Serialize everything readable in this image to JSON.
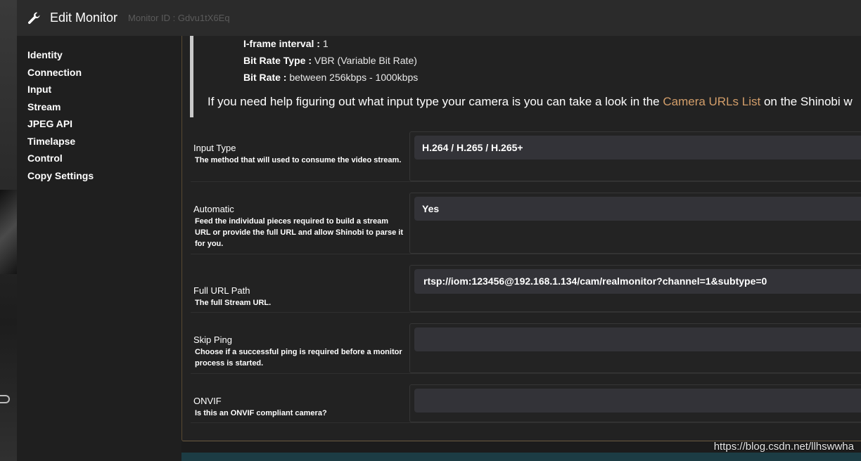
{
  "header": {
    "title": "Edit Monitor",
    "monitor_id": "Monitor ID : Gdvu1tX6Eq"
  },
  "sidebar": {
    "items": [
      {
        "label": "Identity"
      },
      {
        "label": "Connection"
      },
      {
        "label": "Input"
      },
      {
        "label": "Stream"
      },
      {
        "label": "JPEG API"
      },
      {
        "label": "Timelapse"
      },
      {
        "label": "Control"
      },
      {
        "label": "Copy Settings"
      }
    ]
  },
  "note": {
    "iframe_label": "I-frame interval :",
    "iframe_value": " 1",
    "bitrate_type_label": "Bit Rate Type :",
    "bitrate_type_value": " VBR (Variable Bit Rate)",
    "bitrate_label": "Bit Rate :",
    "bitrate_value": " between 256kbps - 1000kbps",
    "help_pre": "If you need help figuring out what input type your camera is you can take a look in the ",
    "help_link": "Camera URLs List",
    "help_post": " on the Shinobi w"
  },
  "fields": {
    "input_type": {
      "label": "Input Type",
      "desc": "The method that will used to consume the video stream.",
      "value": "H.264 / H.265 / H.265+"
    },
    "automatic": {
      "label": "Automatic",
      "desc": "Feed the individual pieces required to build a stream URL or provide the full URL and allow Shinobi to parse it for you.",
      "value": "Yes"
    },
    "full_url": {
      "label": "Full URL Path",
      "desc": "The full Stream URL.",
      "value": "rtsp://iom:123456@192.168.1.134/cam/realmonitor?channel=1&subtype=0"
    },
    "skip_ping": {
      "label": "Skip Ping",
      "desc": "Choose if a successful ping is required before a monitor process is started.",
      "value": ""
    },
    "onvif": {
      "label": "ONVIF",
      "desc": "Is this an ONVIF compliant camera?",
      "value": ""
    }
  },
  "watermark": "https://blog.csdn.net/llhswwha",
  "colors": {
    "accent_link": "#d39e6a",
    "panel_border": "#5a4a32",
    "control_bg": "#333338"
  }
}
